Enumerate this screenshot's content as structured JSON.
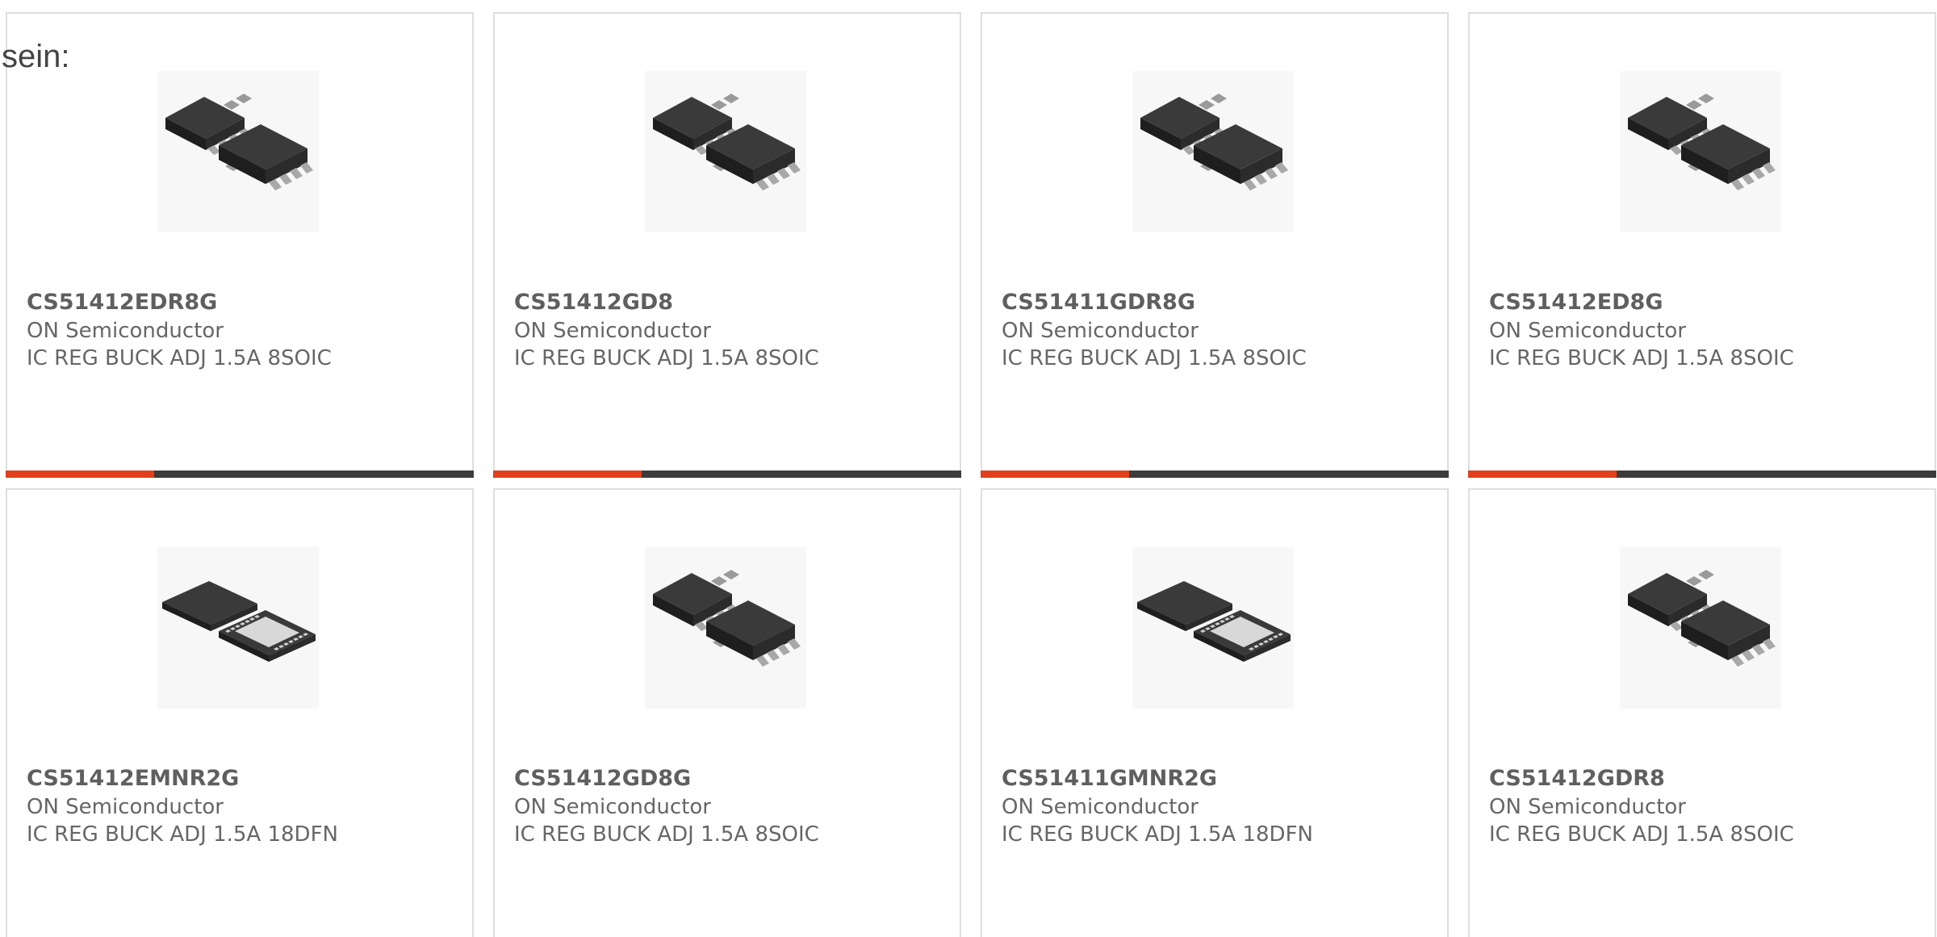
{
  "intro_text": "sein:",
  "colors": {
    "accent": "#e2401c",
    "bar": "#3c3c3c",
    "card_border": "#dedede",
    "text": "#666666"
  },
  "products": [
    {
      "part_number": "CS51412EDR8G",
      "manufacturer": "ON Semiconductor",
      "description": "IC REG BUCK ADJ 1.5A 8SOIC",
      "image_icon": "soic-8-chip-icon"
    },
    {
      "part_number": "CS51412GD8",
      "manufacturer": "ON Semiconductor",
      "description": "IC REG BUCK ADJ 1.5A 8SOIC",
      "image_icon": "soic-8-chip-icon"
    },
    {
      "part_number": "CS51411GDR8G",
      "manufacturer": "ON Semiconductor",
      "description": "IC REG BUCK ADJ 1.5A 8SOIC",
      "image_icon": "soic-8-chip-icon"
    },
    {
      "part_number": "CS51412ED8G",
      "manufacturer": "ON Semiconductor",
      "description": "IC REG BUCK ADJ 1.5A 8SOIC",
      "image_icon": "soic-8-chip-icon"
    },
    {
      "part_number": "CS51412EMNR2G",
      "manufacturer": "ON Semiconductor",
      "description": "IC REG BUCK ADJ 1.5A 18DFN",
      "image_icon": "dfn-18-chip-icon"
    },
    {
      "part_number": "CS51412GD8G",
      "manufacturer": "ON Semiconductor",
      "description": "IC REG BUCK ADJ 1.5A 8SOIC",
      "image_icon": "soic-8-chip-icon"
    },
    {
      "part_number": "CS51411GMNR2G",
      "manufacturer": "ON Semiconductor",
      "description": "IC REG BUCK ADJ 1.5A 18DFN",
      "image_icon": "dfn-18-chip-icon"
    },
    {
      "part_number": "CS51412GDR8",
      "manufacturer": "ON Semiconductor",
      "description": "IC REG BUCK ADJ 1.5A 8SOIC",
      "image_icon": "soic-8-chip-icon"
    }
  ]
}
